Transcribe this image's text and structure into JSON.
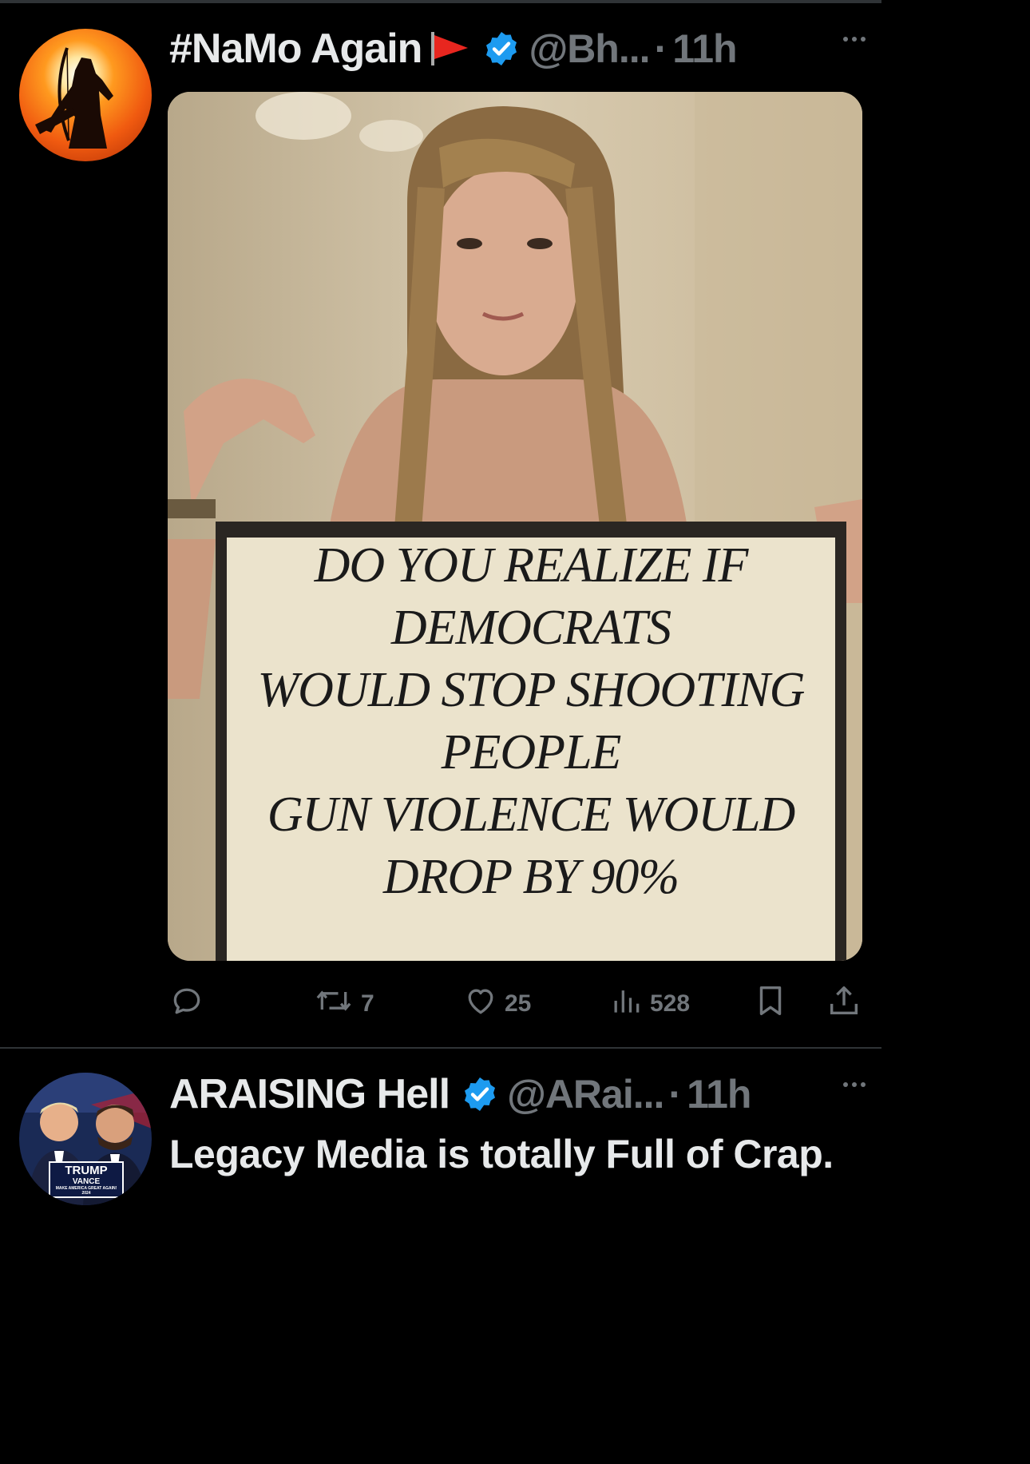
{
  "tweets": [
    {
      "display_name": "#NaMo Again",
      "handle": "@Bh...",
      "time": "11h",
      "media_sign_text": "DO YOU REALIZE IF\nDEMOCRATS\nWOULD STOP SHOOTING\nPEOPLE\nGUN VIOLENCE WOULD\nDROP BY 90%",
      "actions": {
        "reply_count": "",
        "retweet_count": "7",
        "like_count": "25",
        "view_count": "528"
      }
    },
    {
      "display_name": "ARAISING Hell",
      "handle": "@ARai...",
      "time": "11h",
      "text": "Legacy Media is totally Full of Crap.",
      "avatar_text": {
        "line1": "TRUMP",
        "line2": "VANCE",
        "line3": "MAKE AMERICA GREAT AGAIN!",
        "line4": "2024"
      }
    }
  ],
  "colors": {
    "background": "#000000",
    "text_primary": "#e7e9ea",
    "text_secondary": "#71767b",
    "verified": "#1d9bf0",
    "divider": "#2f3336"
  },
  "icons": [
    "flag-icon",
    "verified-badge-icon",
    "more-icon",
    "reply-icon",
    "retweet-icon",
    "like-icon",
    "views-icon",
    "bookmark-icon",
    "share-icon"
  ]
}
